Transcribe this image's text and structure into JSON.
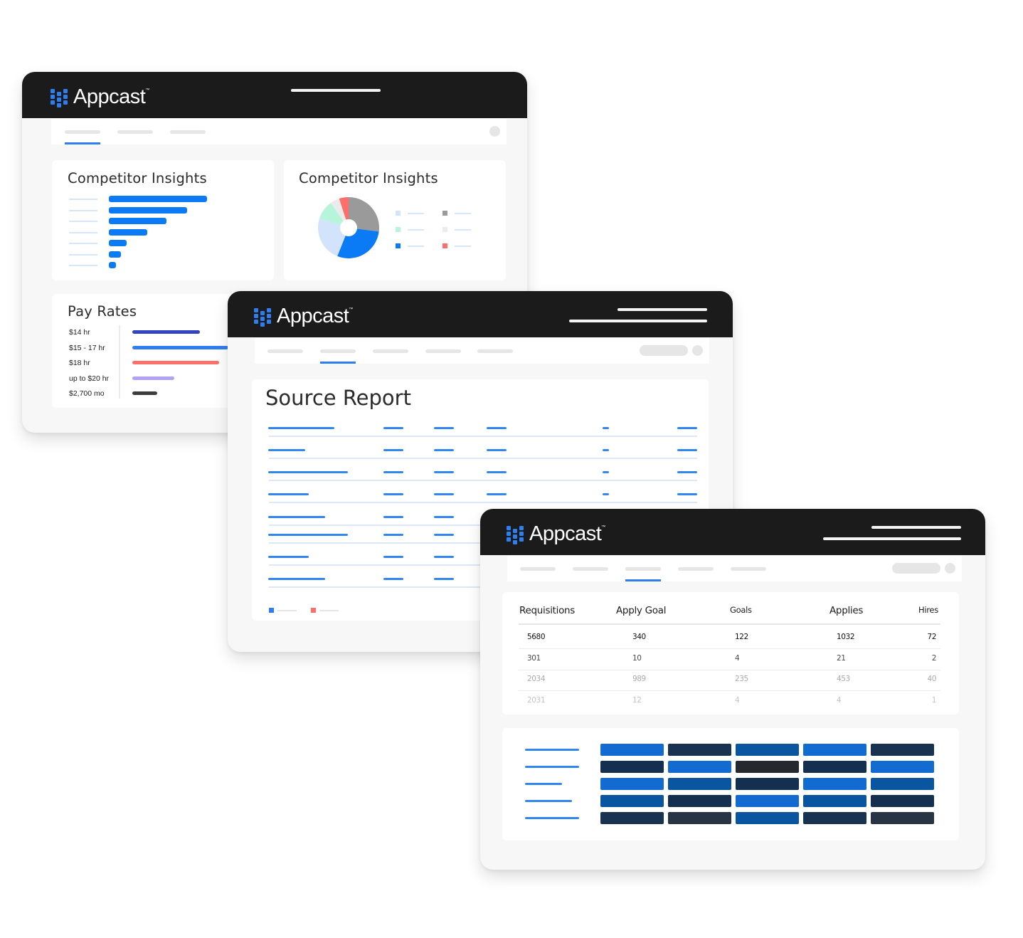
{
  "brand": {
    "name": "Appcast",
    "trademark": "™",
    "accent": "#2f7ef0",
    "titlebar_color": "#1b1b1b"
  },
  "window1": {
    "nav": {
      "tab_count": 3,
      "active_tab_index": 0
    },
    "competitor_bar_card": {
      "title": "Competitor Insights",
      "chart_data": {
        "type": "bar",
        "orientation": "horizontal",
        "categories": [
          "",
          "",
          "",
          "",
          "",
          "",
          ""
        ],
        "values": [
          100,
          80,
          59,
          39,
          18,
          12,
          7
        ],
        "color": "#0a7bf5"
      }
    },
    "competitor_pie_card": {
      "title": "Competitor Insights",
      "chart_data": {
        "type": "pie",
        "donut": true,
        "slices": [
          {
            "label": "",
            "value": 27,
            "color": "#9a9a9a"
          },
          {
            "label": "",
            "value": 29,
            "color": "#0a7bf5"
          },
          {
            "label": "",
            "value": 24,
            "color": "#d3e3fb"
          },
          {
            "label": "",
            "value": 10,
            "color": "#b6f5d9"
          },
          {
            "label": "",
            "value": 5,
            "color": "#ebebeb"
          },
          {
            "label": "",
            "value": 5,
            "color": "#fd6f68"
          }
        ],
        "legend": [
          {
            "color": "#d3e3fb"
          },
          {
            "color": "#9a9a9a"
          },
          {
            "color": "#b6f5d9"
          },
          {
            "color": "#ebebeb"
          },
          {
            "color": "#0a7bf5"
          },
          {
            "color": "#fd6f68"
          }
        ]
      }
    },
    "pay_rates_card": {
      "title": "Pay Rates",
      "chart_data": {
        "type": "bar",
        "orientation": "horizontal",
        "categories": [
          "$14 hr",
          "$15 - 17 hr",
          "$18 hr",
          "up to $20 hr",
          "$2,700 mo"
        ],
        "values": [
          95,
          135,
          122,
          59,
          35
        ],
        "colors": [
          "#3444be",
          "#2f7ef0",
          "#fd6f68",
          "#b2a1f5",
          "#3c3c3c"
        ]
      }
    }
  },
  "window2": {
    "nav": {
      "tab_count": 5,
      "active_tab_index": 1
    },
    "source_report": {
      "title": "Source Report",
      "row_count": 8,
      "legend": [
        {
          "color": "#2f7ef0"
        },
        {
          "color": "#fd6f68"
        }
      ]
    }
  },
  "window3": {
    "nav": {
      "tab_count": 5,
      "active_tab_index": 2
    },
    "table": {
      "columns": [
        "Requisitions",
        "Apply Goal",
        "Goals",
        "Applies",
        "Hires"
      ],
      "rows": [
        [
          "5680",
          "340",
          "122",
          "1032",
          "72"
        ],
        [
          "301",
          "10",
          "4",
          "21",
          "2"
        ],
        [
          "2034",
          "989",
          "235",
          "453",
          "40"
        ],
        [
          "2031",
          "12",
          "4",
          "4",
          "1"
        ]
      ]
    },
    "heatmap": {
      "chart_data": {
        "type": "heatmap",
        "rows": 5,
        "cols": 5,
        "colors": [
          [
            "#126bd0",
            "#18324f",
            "#0a55a0",
            "#126bd0",
            "#18324f"
          ],
          [
            "#152f51",
            "#126bd0",
            "#25292f",
            "#152f51",
            "#126bd0"
          ],
          [
            "#126bd0",
            "#0a55a0",
            "#152f51",
            "#126bd0",
            "#0a55a0"
          ],
          [
            "#0a55a0",
            "#152f51",
            "#126bd0",
            "#0a55a0",
            "#152f51"
          ],
          [
            "#18324f",
            "#263444",
            "#0a55a0",
            "#18324f",
            "#263444"
          ]
        ]
      }
    }
  }
}
